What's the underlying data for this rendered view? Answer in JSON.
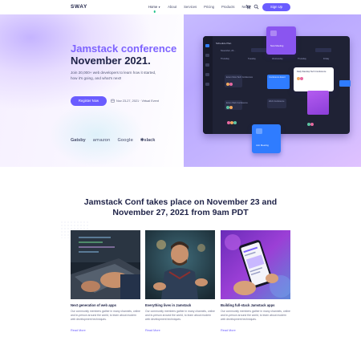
{
  "header": {
    "logo": "SWAY",
    "nav": [
      {
        "label": "Home",
        "active": true,
        "has_dropdown": true
      },
      {
        "label": "About",
        "active": false
      },
      {
        "label": "Services",
        "active": false
      },
      {
        "label": "Pricing",
        "active": false
      },
      {
        "label": "Products",
        "active": false
      },
      {
        "label": "News",
        "active": false
      }
    ],
    "cart_icon": "cart-icon",
    "search_icon": "search-icon",
    "signup_label": "Sign Up"
  },
  "hero": {
    "title_line1": "Jamstack conference",
    "title_line2": "November 2021.",
    "description": "Join 20,000+ web developers to learn how it started, how it's going, and what's next!",
    "register_label": "Register Now",
    "event_date": "Nov 23-27, 2021 · Virtual Event",
    "sponsors": [
      "Gatsby",
      "amazon",
      "Google",
      "slack"
    ]
  },
  "app_mockup": {
    "window_title": "Schedule Plan",
    "month_label": "November, 20...",
    "days": [
      "Thursday",
      "Tuesday",
      "Wednesday",
      "Thursday",
      "Friday"
    ],
    "floating_purple": "New Meeting",
    "floating_blue": "Join Meeting",
    "floating_white": "Daily Standup Tech Conference",
    "event_labels": [
      "Ecom Flow Tech Conference",
      "Conference Event",
      "Ecom Web Conference",
      "Web Conference"
    ]
  },
  "section": {
    "title": "Jamstack Conf takes place on November 23 and November 27, 2021 from 9am PDT",
    "cards": [
      {
        "title": "Next generation of web apps",
        "description": "Our community members gather in many channels, online and in-person around the world, to learn about modern web development techniques.",
        "link": "Read More"
      },
      {
        "title": "Everything lives in Jamstack",
        "description": "Our community members gather in many channels, online and in-person around the world, to learn about modern web development techniques.",
        "link": "Read More"
      },
      {
        "title": "Building full-stack Jamstack apps",
        "description": "Our community members gather in many channels, online and in-person around the world, to learn about modern web development techniques.",
        "link": "Read More"
      }
    ]
  },
  "colors": {
    "accent": "#6a5cff",
    "hero_title_accent": "#7e64ff",
    "heading": "#1e2247",
    "active_dot": "#1ec28b"
  }
}
